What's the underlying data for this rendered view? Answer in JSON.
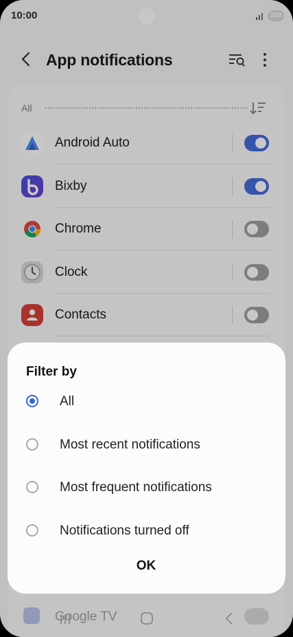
{
  "status": {
    "time": "10:00",
    "battery": "100"
  },
  "header": {
    "title": "App notifications"
  },
  "filter": {
    "label": "All"
  },
  "apps": [
    {
      "name": "Android Auto",
      "enabled": true,
      "icon": "android-auto-icon"
    },
    {
      "name": "Bixby",
      "enabled": true,
      "icon": "bixby-icon"
    },
    {
      "name": "Chrome",
      "enabled": false,
      "icon": "chrome-icon"
    },
    {
      "name": "Clock",
      "enabled": false,
      "icon": "clock-icon"
    },
    {
      "name": "Contacts",
      "enabled": false,
      "icon": "contacts-icon"
    }
  ],
  "behind_app": {
    "name": "Google TV",
    "enabled": false
  },
  "dialog": {
    "title": "Filter by",
    "options": [
      {
        "label": "All",
        "selected": true
      },
      {
        "label": "Most recent notifications",
        "selected": false
      },
      {
        "label": "Most frequent notifications",
        "selected": false
      },
      {
        "label": "Notifications turned off",
        "selected": false
      }
    ],
    "ok": "OK"
  },
  "colors": {
    "accent": "#3a64d8",
    "toggle_off": "#9a9a9a"
  }
}
